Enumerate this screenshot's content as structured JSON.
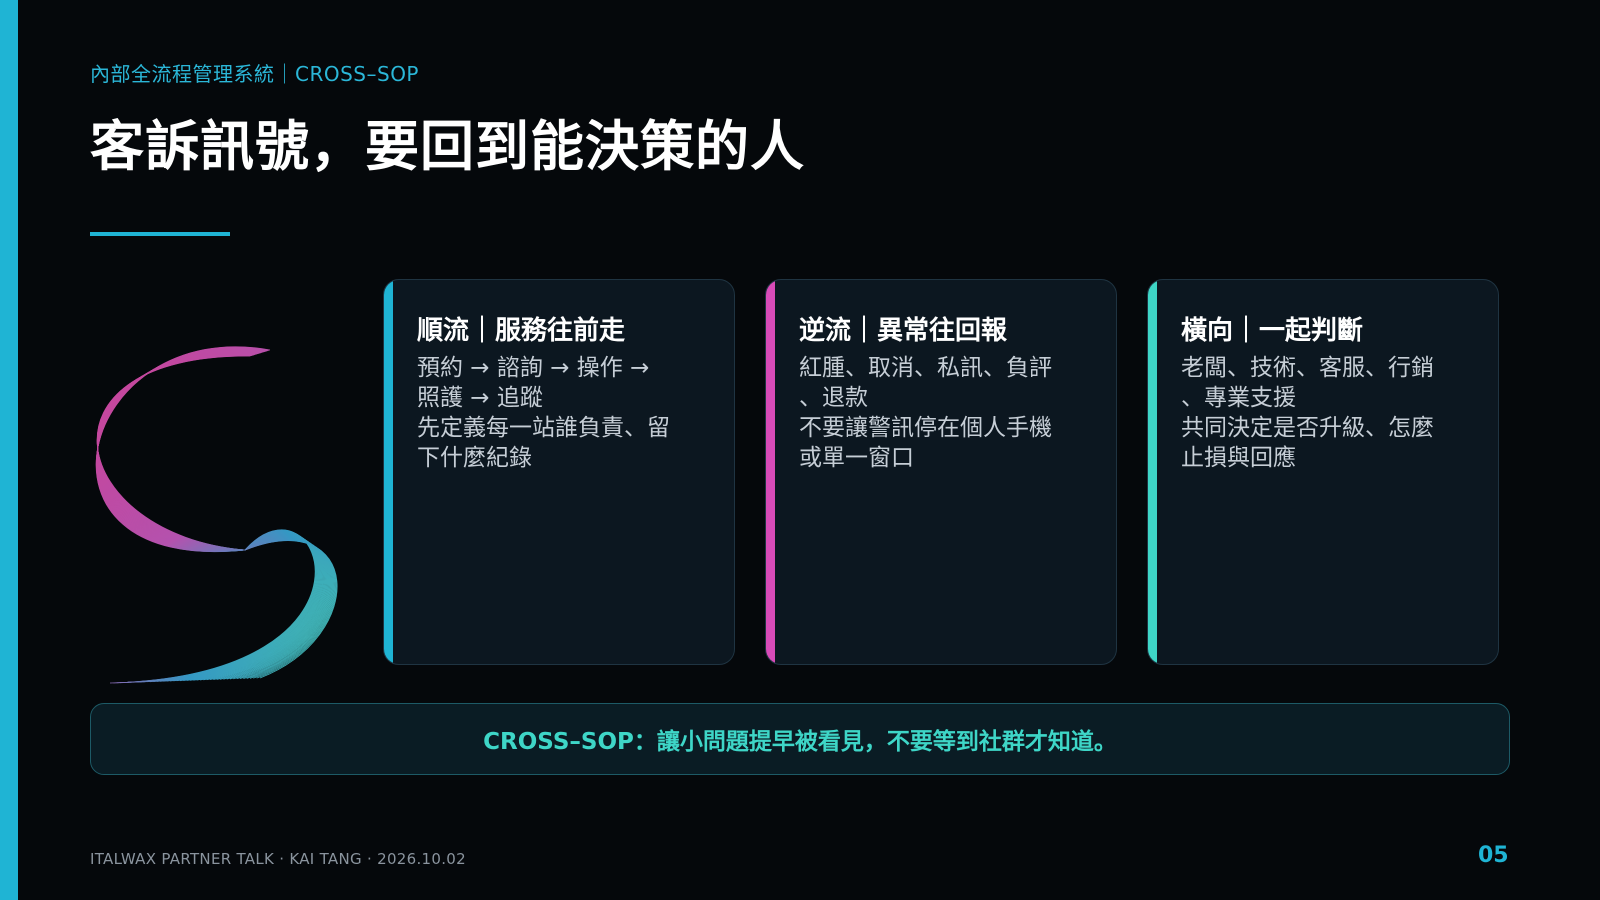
{
  "slide": {
    "eyebrow": "內部全流程管理系統｜CROSS–SOP",
    "title": "客訴訊號，要回到能決策的人",
    "cards": [
      {
        "title": "順流｜服務往前走",
        "accent": "#1fb4d4",
        "lines": [
          "預約 → 諮詢 → 操作 →",
          "照護 → 追蹤",
          "先定義每一站誰負責、留",
          "下什麼紀錄"
        ]
      },
      {
        "title": "逆流｜異常往回報",
        "accent": "#d84bb8",
        "lines": [
          "紅腫、取消、私訊、負評",
          "、退款",
          "不要讓警訊停在個人手機",
          "或單一窗口"
        ]
      },
      {
        "title": "橫向｜一起判斷",
        "accent": "#3ed6c7",
        "lines": [
          "老闆、技術、客服、行銷",
          "、專業支援",
          "共同決定是否升級、怎麼",
          "止損與回應"
        ]
      }
    ],
    "callout": "CROSS–SOP：讓小問題提早被看見，不要等到社群才知道。",
    "footer": "ITALWAX PARTNER TALK · KAI TANG · 2026.10.02",
    "page_number": "05"
  },
  "colors": {
    "brand_cyan": "#1fb4d4",
    "magenta": "#d84bb8",
    "teal": "#3ed6c7",
    "background": "#05080b"
  }
}
